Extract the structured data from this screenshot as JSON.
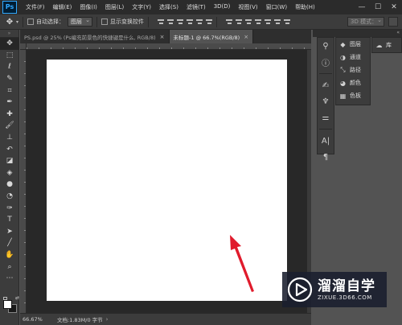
{
  "app": {
    "logo": "Ps",
    "menu": [
      "文件(F)",
      "编辑(E)",
      "图像(I)",
      "图层(L)",
      "文字(Y)",
      "选择(S)",
      "滤镜(T)",
      "3D(D)",
      "视图(V)",
      "窗口(W)",
      "帮助(H)"
    ],
    "window_controls": [
      "—",
      "☐",
      "✕"
    ]
  },
  "options": {
    "auto_select_label": "自动选择：",
    "auto_select_value": "图层",
    "show_transform_label": "显示变换控件",
    "mode_3d_label": "3D 模式："
  },
  "tabs": [
    {
      "label": "PS.psd @ 25% (Ps编充前景色的快捷键是什么, RGB/8)",
      "close": "×"
    },
    {
      "label": "未标题-1 @ 66.7%(RGB/8)",
      "close": "×"
    }
  ],
  "status": {
    "zoom": "66.67%",
    "doc_info": "文档:1.83M/0 字节",
    "chevron": "›"
  },
  "panels": {
    "items": [
      {
        "icon": "◆",
        "label": "图层"
      },
      {
        "icon": "◑",
        "label": "通道"
      },
      {
        "icon": "⤡",
        "label": "路径"
      },
      {
        "icon": "◕",
        "label": "颜色"
      },
      {
        "icon": "▦",
        "label": "色板"
      }
    ],
    "library_label": "库"
  },
  "watermark": {
    "title": "溜溜自学",
    "url": "ZIXUE.3D66.COM"
  },
  "colors": {
    "foreground": "#ffffff",
    "background": "#1a1a1a",
    "arrow": "#e01b2c"
  }
}
